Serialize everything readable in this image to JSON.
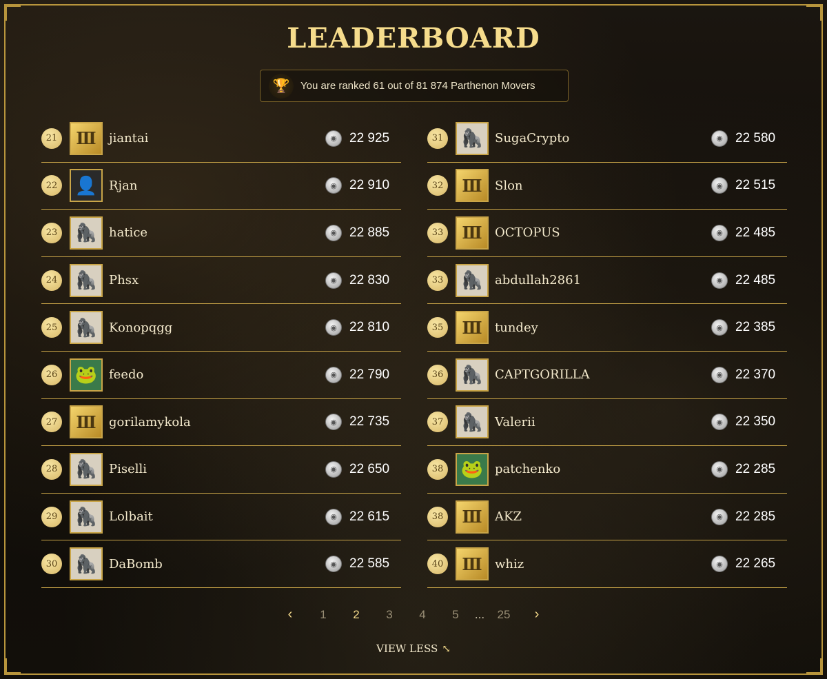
{
  "title": "LEADERBOARD",
  "rank_text": "You are ranked 61 out of 81 874 Parthenon Movers",
  "left": [
    {
      "rank": "21",
      "name": "jiantai",
      "score": "22 925",
      "avatar": "gold"
    },
    {
      "rank": "22",
      "name": "Rjan",
      "score": "22 910",
      "avatar": "photo"
    },
    {
      "rank": "23",
      "name": "hatice",
      "score": "22 885",
      "avatar": "ape"
    },
    {
      "rank": "24",
      "name": "Phsx",
      "score": "22 830",
      "avatar": "ape"
    },
    {
      "rank": "25",
      "name": "Konopqgg",
      "score": "22 810",
      "avatar": "ape"
    },
    {
      "rank": "26",
      "name": "feedo",
      "score": "22 790",
      "avatar": "pepe"
    },
    {
      "rank": "27",
      "name": "gorilamykola",
      "score": "22 735",
      "avatar": "gold"
    },
    {
      "rank": "28",
      "name": "Piselli",
      "score": "22 650",
      "avatar": "ape"
    },
    {
      "rank": "29",
      "name": "Lolbait",
      "score": "22 615",
      "avatar": "ape"
    },
    {
      "rank": "30",
      "name": "DaBomb",
      "score": "22 585",
      "avatar": "ape"
    }
  ],
  "right": [
    {
      "rank": "31",
      "name": "SugaCrypto",
      "score": "22 580",
      "avatar": "ape"
    },
    {
      "rank": "32",
      "name": "Slon",
      "score": "22 515",
      "avatar": "gold"
    },
    {
      "rank": "33",
      "name": "OCTOPUS",
      "score": "22 485",
      "avatar": "gold"
    },
    {
      "rank": "33",
      "name": "abdullah2861",
      "score": "22 485",
      "avatar": "ape"
    },
    {
      "rank": "35",
      "name": "tundey",
      "score": "22 385",
      "avatar": "gold"
    },
    {
      "rank": "36",
      "name": "CAPTGORILLA",
      "score": "22 370",
      "avatar": "ape"
    },
    {
      "rank": "37",
      "name": "Valerii",
      "score": "22 350",
      "avatar": "ape"
    },
    {
      "rank": "38",
      "name": "patchenko",
      "score": "22 285",
      "avatar": "pepe"
    },
    {
      "rank": "38",
      "name": "AKZ",
      "score": "22 285",
      "avatar": "gold"
    },
    {
      "rank": "40",
      "name": "whiz",
      "score": "22 265",
      "avatar": "gold"
    }
  ],
  "pagination": {
    "prev": "‹",
    "next": "›",
    "pages": [
      "1",
      "2",
      "3",
      "4",
      "5"
    ],
    "dots": "...",
    "last": "25",
    "active": "2"
  },
  "view_less": "VIEW LESS",
  "icons": {
    "trophy": "trophy-icon",
    "coin": "coin-icon",
    "collapse": "collapse-icon"
  },
  "colors": {
    "gold": "#f6dc8c",
    "divider": "#c9a548",
    "background": "#0f0c08"
  }
}
